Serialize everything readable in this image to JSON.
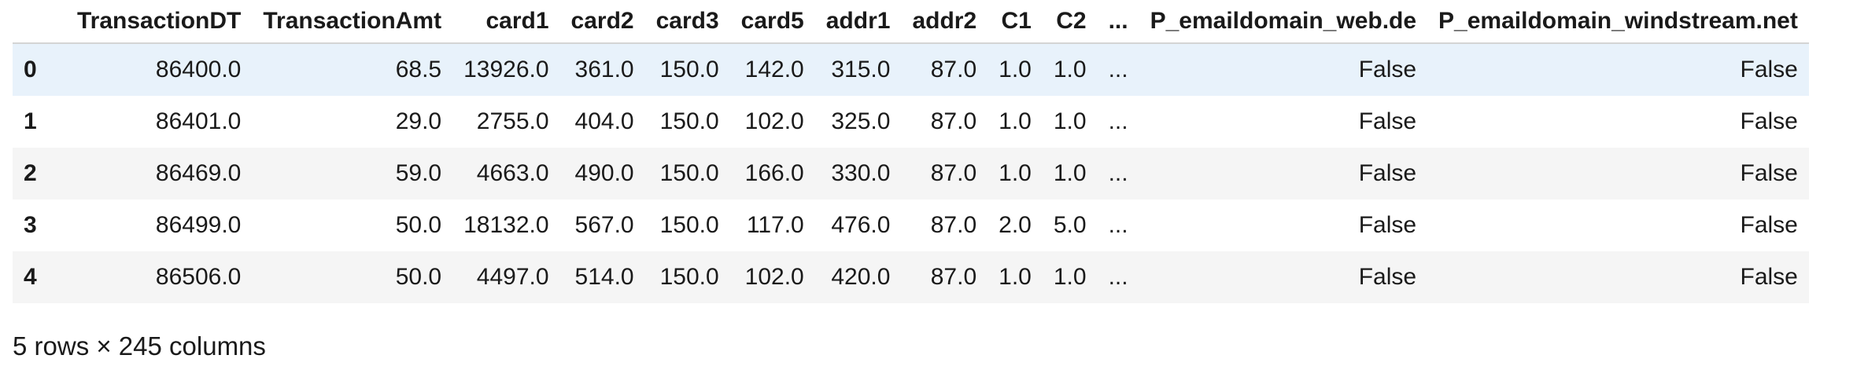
{
  "table": {
    "columns": [
      "TransactionDT",
      "TransactionAmt",
      "card1",
      "card2",
      "card3",
      "card5",
      "addr1",
      "addr2",
      "C1",
      "C2",
      "...",
      "P_emaildomain_web.de",
      "P_emaildomain_windstream.net"
    ],
    "rows": [
      {
        "index": "0",
        "cells": [
          "86400.0",
          "68.5",
          "13926.0",
          "361.0",
          "150.0",
          "142.0",
          "315.0",
          "87.0",
          "1.0",
          "1.0",
          "...",
          "False",
          "False"
        ]
      },
      {
        "index": "1",
        "cells": [
          "86401.0",
          "29.0",
          "2755.0",
          "404.0",
          "150.0",
          "102.0",
          "325.0",
          "87.0",
          "1.0",
          "1.0",
          "...",
          "False",
          "False"
        ]
      },
      {
        "index": "2",
        "cells": [
          "86469.0",
          "59.0",
          "4663.0",
          "490.0",
          "150.0",
          "166.0",
          "330.0",
          "87.0",
          "1.0",
          "1.0",
          "...",
          "False",
          "False"
        ]
      },
      {
        "index": "3",
        "cells": [
          "86499.0",
          "50.0",
          "18132.0",
          "567.0",
          "150.0",
          "117.0",
          "476.0",
          "87.0",
          "2.0",
          "5.0",
          "...",
          "False",
          "False"
        ]
      },
      {
        "index": "4",
        "cells": [
          "86506.0",
          "50.0",
          "4497.0",
          "514.0",
          "150.0",
          "102.0",
          "420.0",
          "87.0",
          "1.0",
          "1.0",
          "...",
          "False",
          "False"
        ]
      }
    ]
  },
  "shape_note": "5 rows × 245 columns"
}
